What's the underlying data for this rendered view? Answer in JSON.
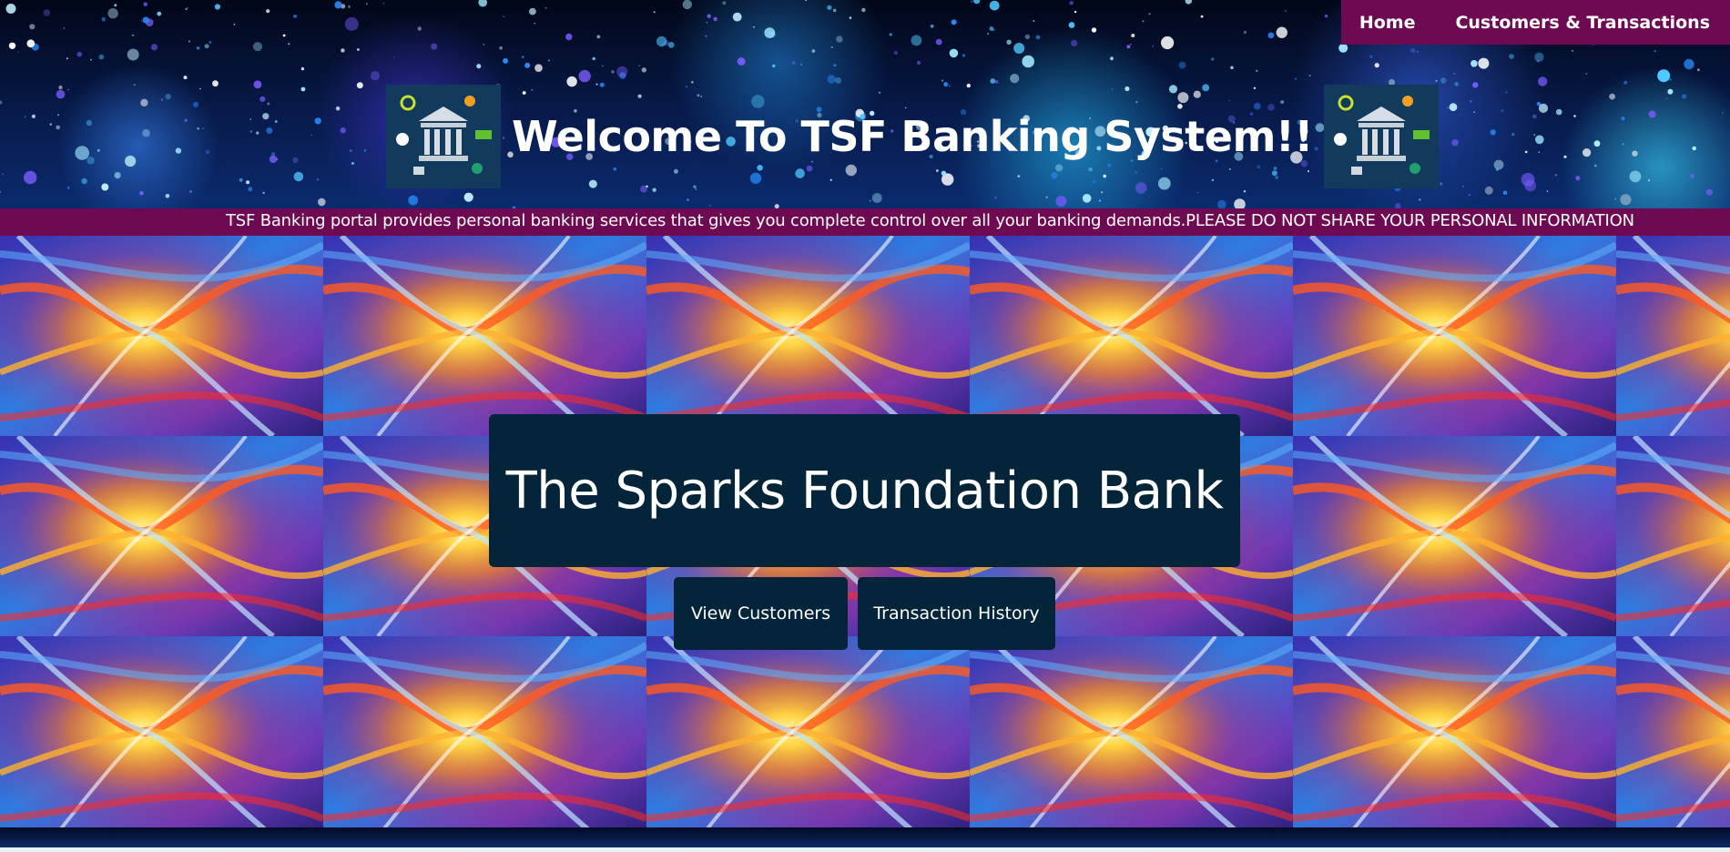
{
  "nav": {
    "home_label": "Home",
    "customers_label": "Customers & Transactions"
  },
  "header": {
    "title": "Welcome To TSF Banking System!!",
    "logo_icon": "bank-icon"
  },
  "notice": {
    "text": "TSF Banking portal provides personal banking services that gives you complete control over all your banking demands.PLEASE DO NOT SHARE YOUR PERSONAL INFORMATION"
  },
  "hero": {
    "title": "The Sparks Foundation Bank",
    "view_customers_label": "View Customers",
    "transaction_history_label": "Transaction History"
  },
  "colors": {
    "nav_bg": "#6e0a52",
    "card_bg": "#042439",
    "text": "#ffffff"
  }
}
